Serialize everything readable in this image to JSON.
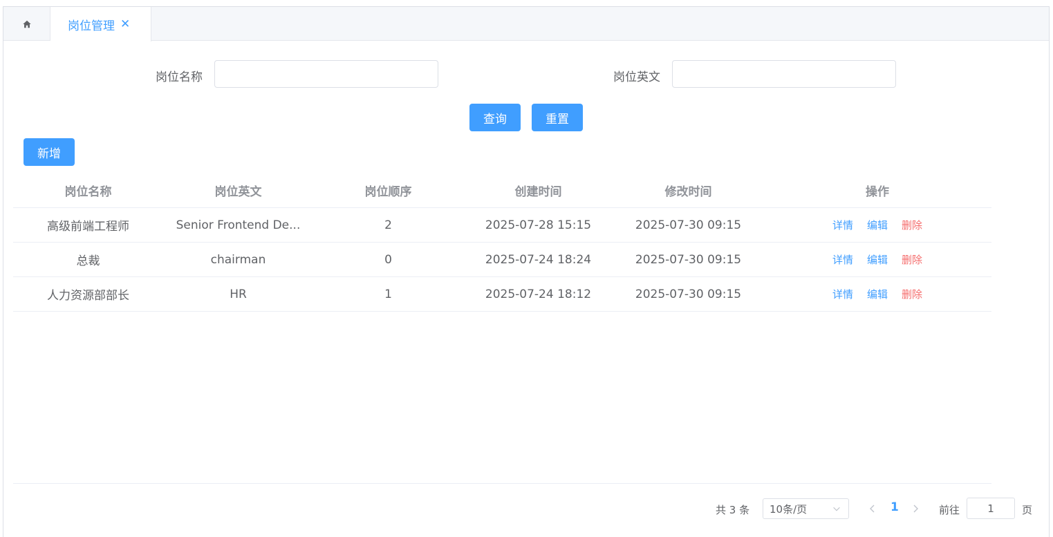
{
  "tabs": {
    "home_icon": "home-icon",
    "active_label": "岗位管理",
    "close_glyph": "✕"
  },
  "search": {
    "name_label": "岗位名称",
    "name_value": "",
    "english_label": "岗位英文",
    "english_value": "",
    "query_button": "查询",
    "reset_button": "重置"
  },
  "actions": {
    "add_button": "新增"
  },
  "table": {
    "headers": [
      "岗位名称",
      "岗位英文",
      "岗位顺序",
      "创建时间",
      "修改时间",
      "操作"
    ],
    "rows": [
      {
        "name": "高级前端工程师",
        "english": "Senior Frontend De...",
        "order": "2",
        "created": "2025-07-28 15:15",
        "modified": "2025-07-30 09:15"
      },
      {
        "name": "总裁",
        "english": "chairman",
        "order": "0",
        "created": "2025-07-24 18:24",
        "modified": "2025-07-30 09:15"
      },
      {
        "name": "人力资源部部长",
        "english": "HR",
        "order": "1",
        "created": "2025-07-24 18:12",
        "modified": "2025-07-30 09:15"
      }
    ],
    "op_detail": "详情",
    "op_edit": "编辑",
    "op_delete": "删除"
  },
  "pagination": {
    "total": "共 3 条",
    "page_size": "10条/页",
    "current_page": "1",
    "goto_label": "前往",
    "goto_value": "1",
    "page_unit": "页"
  },
  "colors": {
    "primary": "#409eff",
    "danger": "#f56c6c"
  }
}
